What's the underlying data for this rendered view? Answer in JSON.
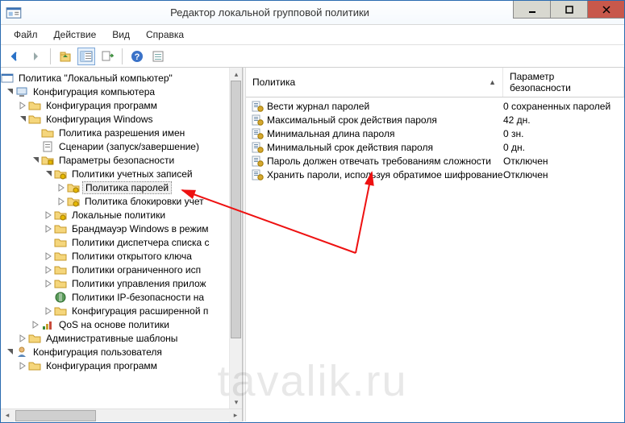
{
  "window": {
    "title": "Редактор локальной групповой политики"
  },
  "menu": {
    "file": "Файл",
    "action": "Действие",
    "view": "Вид",
    "help": "Справка"
  },
  "tree": {
    "root": "Политика \"Локальный компьютер\"",
    "computer_config": "Конфигурация компьютера",
    "software_config": "Конфигурация программ",
    "windows_config": "Конфигурация Windows",
    "name_res_policy": "Политика разрешения имен",
    "scripts": "Сценарии (запуск/завершение)",
    "security_settings": "Параметры безопасности",
    "account_policies": "Политики учетных записей",
    "password_policy": "Политика паролей",
    "lockout_policy": "Политика блокировки учет",
    "local_policies": "Локальные политики",
    "firewall": "Брандмауэр Windows в режим",
    "netlist": "Политики диспетчера списка с",
    "public_key": "Политики открытого ключа",
    "restricted": "Политики ограниченного исп",
    "app_control": "Политики управления прилож",
    "ipsec": "Политики IP-безопасности на",
    "advanced_audit": "Конфигурация расширенной п",
    "qos": "QoS на основе политики",
    "admin_templates": "Административные шаблоны",
    "user_config": "Конфигурация пользователя",
    "user_software_config": "Конфигурация программ"
  },
  "list": {
    "col_policy": "Политика",
    "col_param": "Параметр безопасности",
    "rows": [
      {
        "name": "Вести журнал паролей",
        "value": "0 сохраненных паролей"
      },
      {
        "name": "Максимальный срок действия пароля",
        "value": "42 дн."
      },
      {
        "name": "Минимальная длина пароля",
        "value": "0 зн."
      },
      {
        "name": "Минимальный срок действия пароля",
        "value": "0 дн."
      },
      {
        "name": "Пароль должен отвечать требованиям сложности",
        "value": "Отключен"
      },
      {
        "name": "Хранить пароли, используя обратимое шифрование",
        "value": "Отключен"
      }
    ]
  },
  "watermark": "tavalik.ru"
}
